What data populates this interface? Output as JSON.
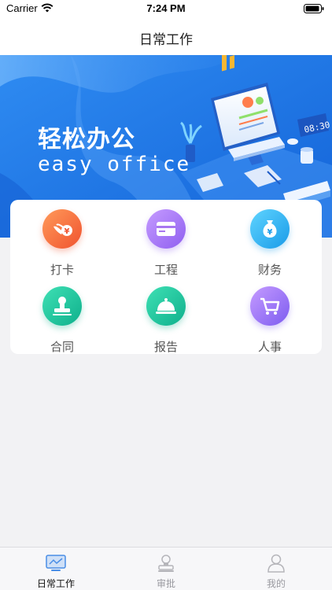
{
  "status_bar": {
    "carrier": "Carrier",
    "time": "7:24 PM"
  },
  "nav": {
    "title": "日常工作"
  },
  "banner": {
    "title": "轻松办公",
    "subtitle": "easy office",
    "clock_text": "08:30"
  },
  "menu": {
    "items": [
      {
        "label": "打卡",
        "icon": "clock-in-icon",
        "color": "#f56a3f"
      },
      {
        "label": "工程",
        "icon": "card-icon",
        "color": "#a877f0"
      },
      {
        "label": "财务",
        "icon": "money-bag-icon",
        "color": "#2bb6ef"
      },
      {
        "label": "合同",
        "icon": "stamp-icon",
        "color": "#18c7a1"
      },
      {
        "label": "报告",
        "icon": "cloche-icon",
        "color": "#18c7a1"
      },
      {
        "label": "人事",
        "icon": "cart-icon",
        "color": "#9a6ff0"
      }
    ]
  },
  "tabs": [
    {
      "label": "日常工作",
      "icon": "monitor-icon",
      "active": true
    },
    {
      "label": "审批",
      "icon": "approval-icon",
      "active": false
    },
    {
      "label": "我的",
      "icon": "user-icon",
      "active": false
    }
  ],
  "colors": {
    "primary": "#1e7bea",
    "banner_light": "#6fb6ff",
    "tab_inactive": "#9a9aa0",
    "tab_active": "#111111"
  }
}
